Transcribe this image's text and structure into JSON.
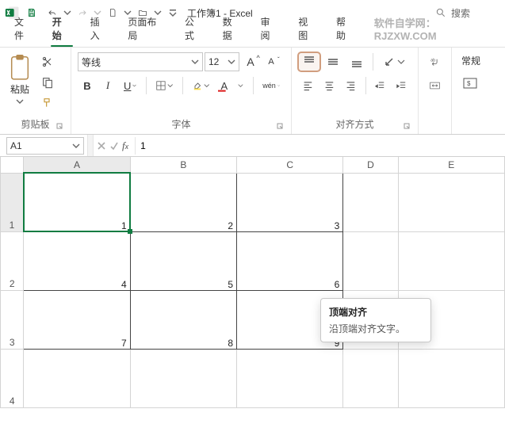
{
  "title": "工作簿1 - Excel",
  "search_placeholder": "搜索",
  "ad_text": "软件自学网：RJZXW.COM",
  "tabs": [
    "文件",
    "开始",
    "插入",
    "页面布局",
    "公式",
    "数据",
    "审阅",
    "视图",
    "帮助"
  ],
  "active_tab_index": 1,
  "clipboard": {
    "paste_label": "粘贴",
    "group_label": "剪贴板"
  },
  "font": {
    "name": "等线",
    "size": "12",
    "group_label": "字体",
    "wen_label": "wén"
  },
  "alignment": {
    "group_label": "对齐方式"
  },
  "number": {
    "general_label": "常规"
  },
  "tooltip": {
    "title": "顶端对齐",
    "body": "沿顶端对齐文字。"
  },
  "namebox": "A1",
  "formula_value": "1",
  "columns": [
    "A",
    "B",
    "C",
    "D",
    "E"
  ],
  "rows": [
    "1",
    "2",
    "3",
    "4"
  ],
  "chart_data": {
    "type": "table",
    "columns": [
      "A",
      "B",
      "C"
    ],
    "rows": [
      {
        "row": "1",
        "values": [
          "1",
          "2",
          "3"
        ]
      },
      {
        "row": "2",
        "values": [
          "4",
          "5",
          "6"
        ]
      },
      {
        "row": "3",
        "values": [
          "7",
          "8",
          "9"
        ]
      }
    ]
  }
}
